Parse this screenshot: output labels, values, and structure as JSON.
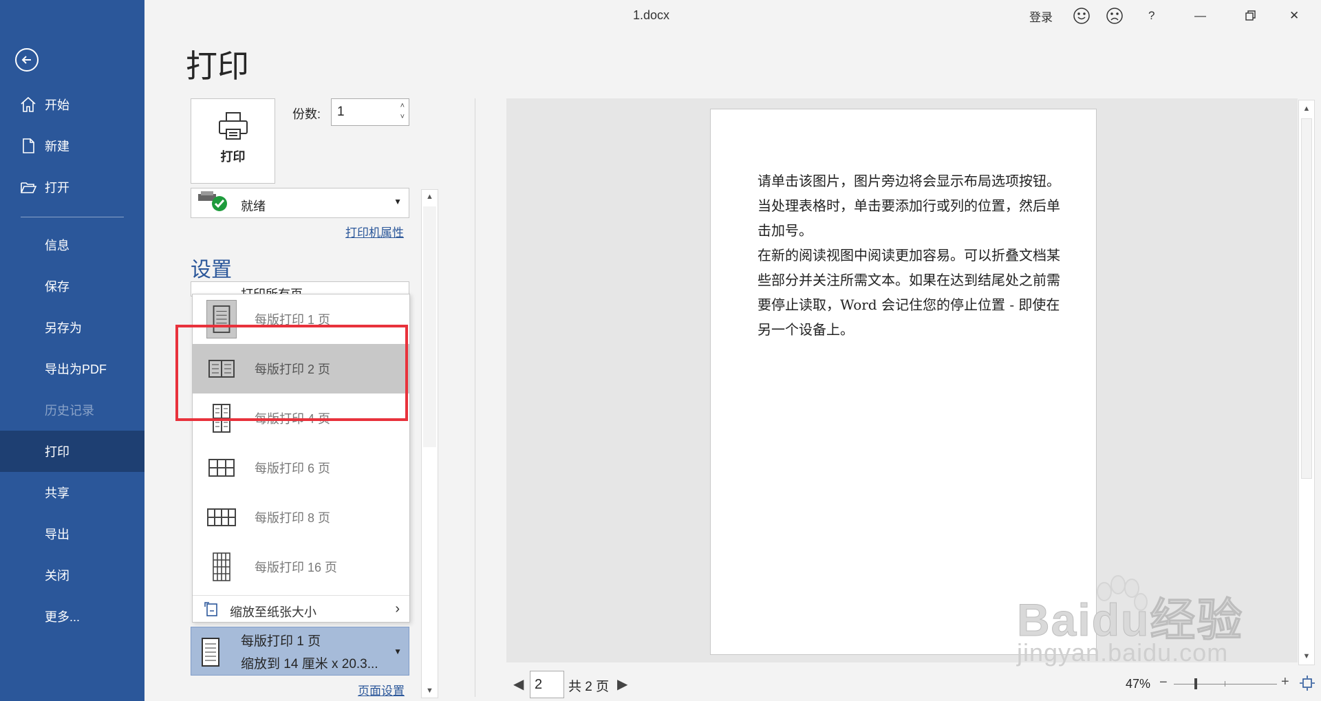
{
  "window": {
    "title": "1.docx",
    "signin": "登录",
    "help": "?",
    "minimize": "—",
    "close": "✕"
  },
  "sidebar": {
    "items": [
      {
        "label": "开始"
      },
      {
        "label": "新建"
      },
      {
        "label": "打开"
      },
      {
        "label": "信息"
      },
      {
        "label": "保存"
      },
      {
        "label": "另存为"
      },
      {
        "label": "导出为PDF"
      },
      {
        "label": "历史记录"
      },
      {
        "label": "打印"
      },
      {
        "label": "共享"
      },
      {
        "label": "导出"
      },
      {
        "label": "关闭"
      },
      {
        "label": "更多..."
      }
    ]
  },
  "print": {
    "heading": "打印",
    "button_label": "打印",
    "copies_label": "份数:",
    "copies_value": "1",
    "printer_status": "就绪",
    "printer_properties": "打印机属性",
    "settings_heading": "设置",
    "print_all_pages": "打印所有页",
    "pages_per_sheet_options": [
      {
        "label": "每版打印 1 页"
      },
      {
        "label": "每版打印 2 页"
      },
      {
        "label": "每版打印 4 页"
      },
      {
        "label": "每版打印 6 页"
      },
      {
        "label": "每版打印 8 页"
      },
      {
        "label": "每版打印 16 页"
      }
    ],
    "scale_to_paper": "缩放至纸张大小",
    "current_pages_per_sheet": "每版打印 1 页",
    "current_scale": "缩放到 14 厘米 x 20.3...",
    "page_setup": "页面设置"
  },
  "preview": {
    "paragraph1": "请单击该图片，图片旁边将会显示布局选项按钮。当处理表格时，单击要添加行或列的位置，然后单击加号。",
    "paragraph2": "在新的阅读视图中阅读更加容易。可以折叠文档某些部分并关注所需文本。如果在达到结尾处之前需要停止读取，Word 会记住您的停止位置 - 即使在另一个设备上。",
    "page_current": "2",
    "page_total": "共 2 页",
    "zoom": "47%",
    "zoom_minus": "−",
    "zoom_plus": "+"
  },
  "watermark": {
    "text1": "Baidu经验",
    "text2": "jingyan.baidu.com"
  },
  "colors": {
    "sidebar": "#2b579a",
    "sidebar_active": "#1e3f72",
    "link": "#2b579a",
    "highlight_box": "#e8323c"
  }
}
